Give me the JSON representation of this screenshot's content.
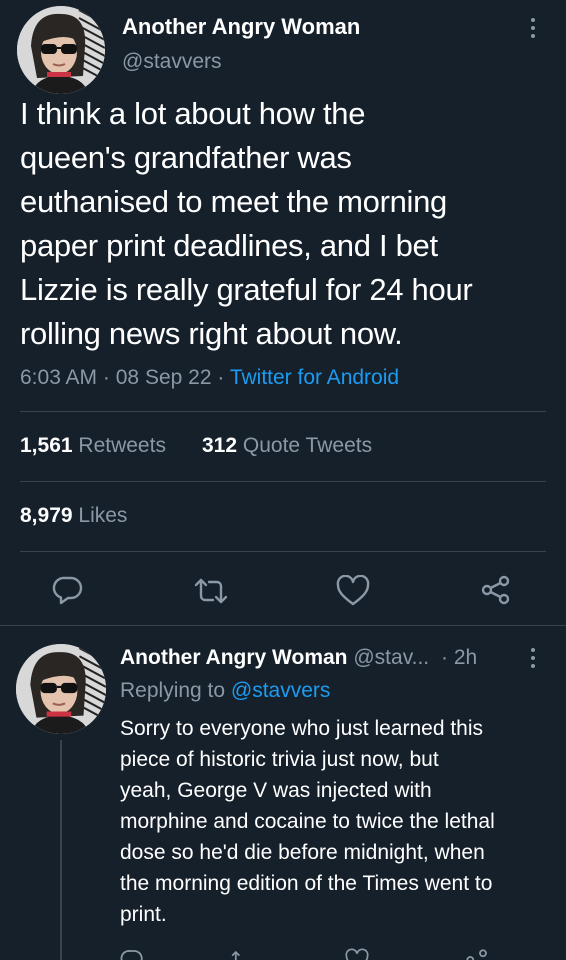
{
  "main_tweet": {
    "author_name": "Another Angry Woman",
    "handle": "@stavvers",
    "text_lines": [
      "I think a lot about how the",
      "queen's grandfather was",
      "euthanised to meet the morning",
      "paper print deadlines, and I bet",
      "Lizzie is really grateful for 24 hour",
      "rolling news right about now."
    ],
    "time": "6:03 AM",
    "date": "08 Sep 22",
    "source": "Twitter for Android",
    "separator": "·",
    "retweets_count": "1,561",
    "retweets_label": "Retweets",
    "quote_count": "312",
    "quote_label": "Quote Tweets",
    "likes_count": "8,979",
    "likes_label": "Likes"
  },
  "reply": {
    "author_name": "Another Angry Woman",
    "handle": "@stav...",
    "time_ago": "2h",
    "separator": "·",
    "replying_label": "Replying to",
    "replying_handle": "@stavvers",
    "text_lines": [
      "Sorry to everyone who just learned this",
      "piece of historic trivia just now, but",
      "yeah, George V was injected with",
      "morphine and cocaine to twice the lethal",
      "dose so he'd die before midnight, when",
      "the morning edition of the Times went to",
      "print."
    ]
  },
  "colors": {
    "background": "#15202b",
    "muted": "#8b98a5",
    "link": "#1d9bf0",
    "divider": "#38444d"
  },
  "icons": {
    "reply": "reply-icon",
    "retweet": "retweet-icon",
    "like": "heart-icon",
    "share": "share-icon",
    "more": "more-vertical-icon"
  }
}
